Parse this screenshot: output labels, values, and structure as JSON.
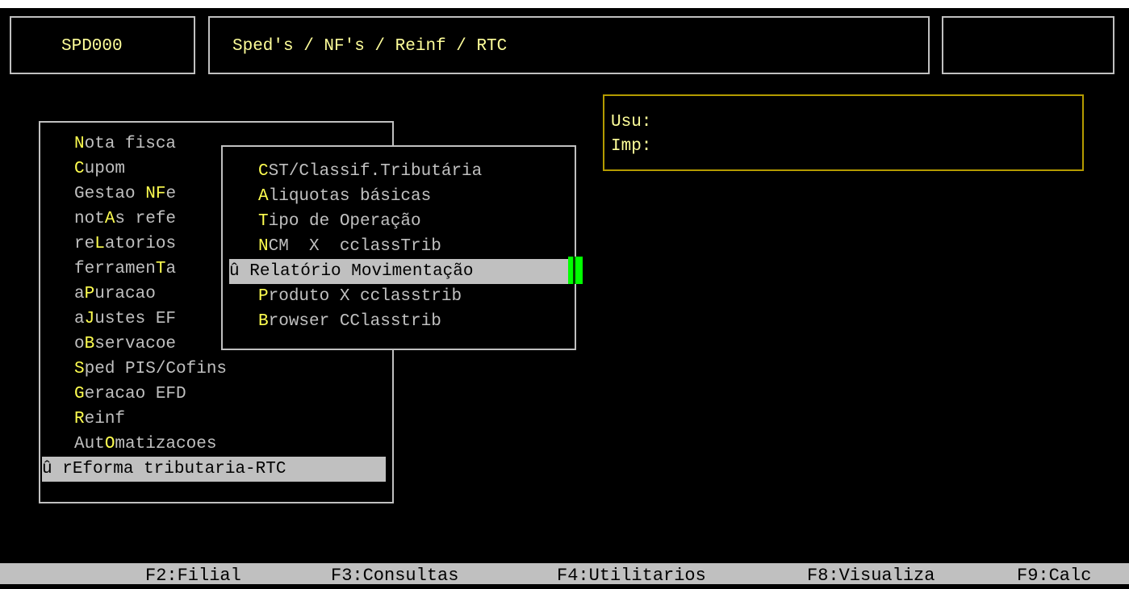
{
  "header": {
    "code": "SPD000",
    "title": "Sped's / NF's / Reinf / RTC",
    "right": ""
  },
  "user_box": {
    "usu_label": "Usu:",
    "imp_label": "Imp:"
  },
  "main_menu": {
    "items": [
      {
        "pre": "",
        "hk": "N",
        "post": "ota fisca"
      },
      {
        "pre": "",
        "hk": "C",
        "post": "upom"
      },
      {
        "pre": "Gestao ",
        "hk": "NF",
        "post": "e"
      },
      {
        "pre": "not",
        "hk": "A",
        "post": "s refe"
      },
      {
        "pre": "re",
        "hk": "L",
        "post": "atorios"
      },
      {
        "pre": "ferramen",
        "hk": "T",
        "post": "a"
      },
      {
        "pre": "a",
        "hk": "P",
        "post": "uracao"
      },
      {
        "pre": "a",
        "hk": "J",
        "post": "ustes EF"
      },
      {
        "pre": "o",
        "hk": "B",
        "post": "servacoe"
      },
      {
        "pre": "",
        "hk": "S",
        "post": "ped PIS/Cofins"
      },
      {
        "pre": "",
        "hk": "G",
        "post": "eracao EFD"
      },
      {
        "pre": "",
        "hk": "R",
        "post": "einf"
      },
      {
        "pre": "Aut",
        "hk": "O",
        "post": "matizacoes"
      },
      {
        "pre": "û r",
        "hk": "E",
        "post": "forma tributaria-RTC"
      }
    ]
  },
  "sub_menu": {
    "items": [
      {
        "pre": "",
        "hk": "C",
        "post": "ST/Classif.Tributária"
      },
      {
        "pre": "",
        "hk": "A",
        "post": "liquotas básicas"
      },
      {
        "pre": "",
        "hk": "T",
        "post": "ipo de Operação"
      },
      {
        "pre": "",
        "hk": "N",
        "post": "CM  X  cclassTrib"
      },
      {
        "pre": "û ",
        "hk": "R",
        "post": "elatório Movimentação"
      },
      {
        "pre": "",
        "hk": "P",
        "post": "roduto X cclasstrib"
      },
      {
        "pre": "",
        "hk": "B",
        "post": "rowser CClasstrib"
      }
    ]
  },
  "fkeys": [
    "F2:Filial",
    "F3:Consultas",
    "F4:Utilitarios",
    "F8:Visualiza",
    "F9:Calc"
  ]
}
